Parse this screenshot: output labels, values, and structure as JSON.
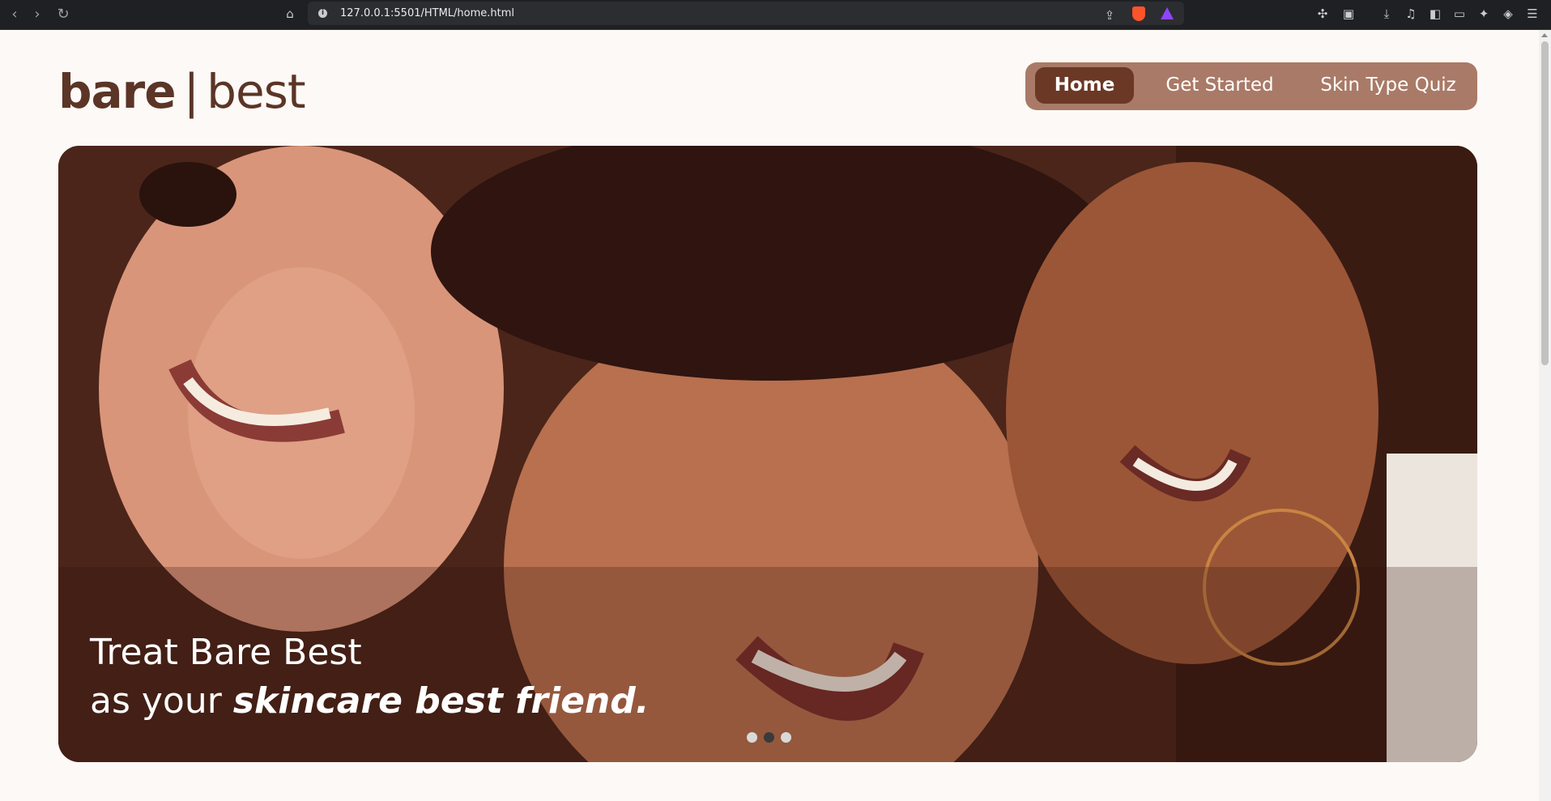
{
  "browser": {
    "url": "127.0.0.1:5501/HTML/home.html",
    "back_icon": "chevron-left-icon",
    "forward_icon": "chevron-right-icon",
    "reload_icon": "reload-icon"
  },
  "brand": {
    "bare": "bare",
    "separator": "|",
    "best": "best"
  },
  "nav": {
    "items": [
      {
        "label": "Home",
        "active": true
      },
      {
        "label": "Get Started",
        "active": false
      },
      {
        "label": "Skin Type Quiz",
        "active": false
      }
    ]
  },
  "hero": {
    "line1": "Treat Bare Best",
    "line2_prefix": "as your ",
    "line2_emphasis": "skincare best friend.",
    "slides_total": 3,
    "active_slide_index": 1
  },
  "colors": {
    "brand_brown": "#5b3526",
    "nav_background": "#a97a67",
    "nav_active": "#6b3826",
    "page_background": "#fdf9f6"
  }
}
